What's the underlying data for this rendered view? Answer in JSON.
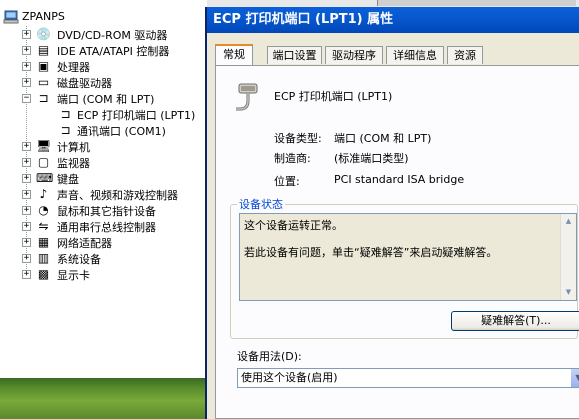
{
  "tree": {
    "root": "ZPANPS",
    "items": [
      {
        "label": "DVD/CD-ROM 驱动器",
        "icon": "cdrom-icon",
        "expanded": false
      },
      {
        "label": "IDE ATA/ATAPI 控制器",
        "icon": "ide-controller-icon",
        "expanded": false
      },
      {
        "label": "处理器",
        "icon": "processor-icon",
        "expanded": false
      },
      {
        "label": "磁盘驱动器",
        "icon": "disk-drive-icon",
        "expanded": false
      },
      {
        "label": "端口 (COM 和 LPT)",
        "icon": "port-icon",
        "expanded": true,
        "children": [
          "ECP 打印机端口 (LPT1)",
          "通讯端口 (COM1)"
        ]
      },
      {
        "label": "计算机",
        "icon": "computer-icon",
        "expanded": false
      },
      {
        "label": "监视器",
        "icon": "monitor-icon",
        "expanded": false
      },
      {
        "label": "键盘",
        "icon": "keyboard-icon",
        "expanded": false
      },
      {
        "label": "声音、视频和游戏控制器",
        "icon": "sound-icon",
        "expanded": false
      },
      {
        "label": "鼠标和其它指针设备",
        "icon": "mouse-icon",
        "expanded": false
      },
      {
        "label": "通用串行总线控制器",
        "icon": "usb-icon",
        "expanded": false
      },
      {
        "label": "网络适配器",
        "icon": "network-adapter-icon",
        "expanded": false
      },
      {
        "label": "系统设备",
        "icon": "system-device-icon",
        "expanded": false
      },
      {
        "label": "显示卡",
        "icon": "display-adapter-icon",
        "expanded": false
      }
    ]
  },
  "dialog": {
    "title": "ECP 打印机端口 (LPT1) 属性",
    "tabs": [
      "常规",
      "端口设置",
      "驱动程序",
      "详细信息",
      "资源"
    ],
    "active_tab": "常规",
    "device_name": "ECP 打印机端口 (LPT1)",
    "device_type_label": "设备类型:",
    "device_type_value": "端口 (COM 和 LPT)",
    "manufacturer_label": "制造商:",
    "manufacturer_value": "(标准端口类型)",
    "location_label": "位置:",
    "location_value": "PCI standard ISA bridge",
    "status_group_label": "设备状态",
    "status_line1": "这个设备运转正常。",
    "status_line2": "若此设备有问题，单击“疑难解答”来启动疑难解答。",
    "troubleshoot_button": "疑难解答(T)...",
    "usage_label": "设备用法(D):",
    "usage_value": "使用这个设备(启用)"
  },
  "colors": {
    "titlebar": "#0858d0",
    "dialog_bg": "#ece9d8",
    "tab_highlight": "#e68b2c",
    "group_label": "#0046d5"
  }
}
